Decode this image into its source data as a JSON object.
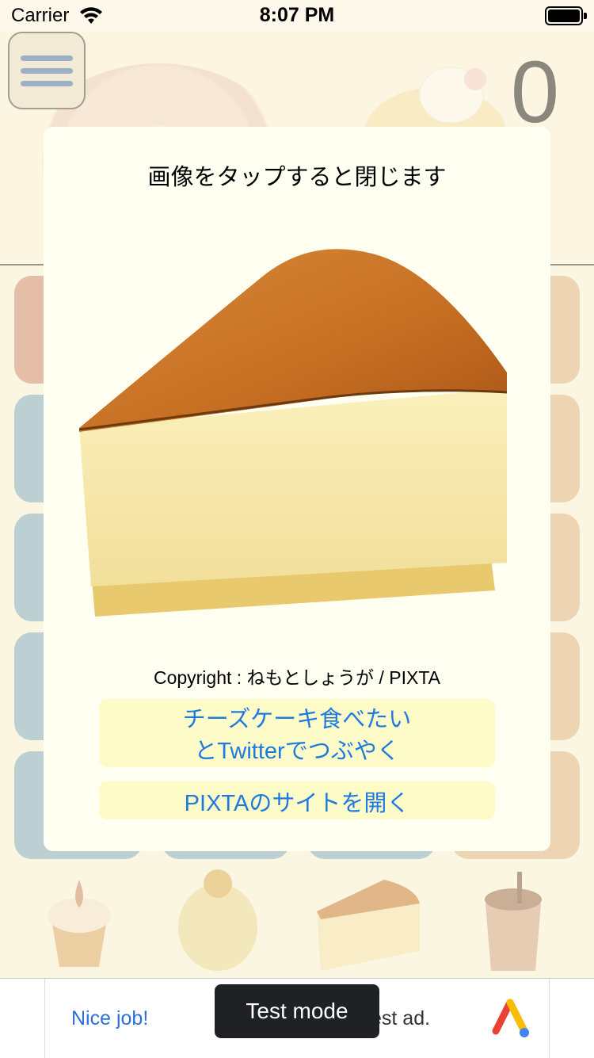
{
  "status_bar": {
    "carrier": "Carrier",
    "time": "8:07 PM",
    "wifi_icon": "wifi-icon",
    "battery_icon": "battery-icon"
  },
  "game": {
    "score": "0",
    "menu_icon": "hamburger-icon"
  },
  "modal": {
    "title": "画像をタップすると閉じます",
    "image_icon": "cheesecake-illustration",
    "copyright": "Copyright : ねもとしょうが / PIXTA",
    "tweet_button_line1": "チーズケーキ食べたい",
    "tweet_button_line2": "とTwitterでつぶやく",
    "pixta_button": "PIXTAのサイトを開く"
  },
  "ad": {
    "left_text": "Nice job!",
    "right_text": "est ad.",
    "toast": "Test mode",
    "logo_icon": "adchoices-logo"
  },
  "colors": {
    "link_blue": "#1f7ae0",
    "button_bg": "#fdfcc8",
    "modal_bg": "#fffff2",
    "tile_red": "#c97a62",
    "tile_blue": "#6f9fbf",
    "tile_orange": "#dcae7a"
  }
}
